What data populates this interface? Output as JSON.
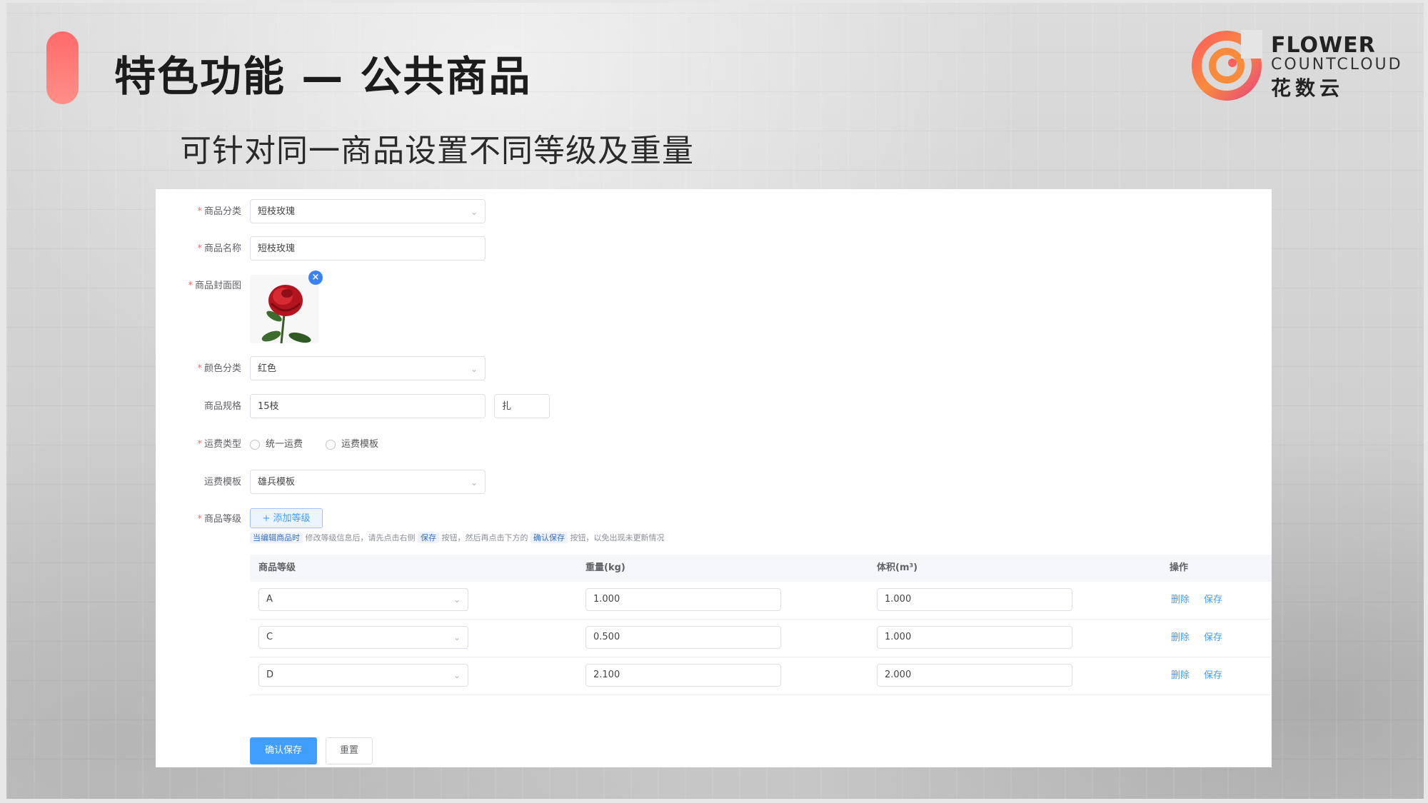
{
  "slide": {
    "title": "特色功能 — 公共商品",
    "subtitle": "可针对同一商品设置不同等级及重量"
  },
  "logo": {
    "line1": "FLOWER",
    "line2": "COUNTCLOUD",
    "line3": "花数云",
    "colors": [
      "#ff5f5f",
      "#f98b3c",
      "#e94b7a"
    ]
  },
  "form": {
    "category": {
      "label": "商品分类",
      "value": "短枝玫瑰",
      "required": "*"
    },
    "name": {
      "label": "商品名称",
      "value": "短枝玫瑰",
      "required": "*"
    },
    "cover": {
      "label": "商品封面图",
      "required": "*",
      "remove_icon": "×"
    },
    "color": {
      "label": "颜色分类",
      "value": "红色",
      "required": "*"
    },
    "spec": {
      "label": "商品规格",
      "value": "15枝",
      "unit": "扎"
    },
    "shipping_type": {
      "label": "运费类型",
      "required": "*",
      "options": [
        "统一运费",
        "运费模板"
      ]
    },
    "shipping_template": {
      "label": "运费模板",
      "value": "雄兵模板"
    },
    "grade": {
      "label": "商品等级",
      "required": "*",
      "add_button": "+ 添加等级",
      "hint_tag1": "当编辑商品时",
      "hint_text1": "修改等级信息后，请先点击右侧",
      "hint_tag2": "保存",
      "hint_text2": "按钮，然后再点击下方的",
      "hint_tag3": "确认保存",
      "hint_text3": "按钮，以免出现未更新情况"
    }
  },
  "table": {
    "headers": [
      "商品等级",
      "重量(kg)",
      "体积(m³)",
      "操作"
    ],
    "rows": [
      {
        "grade": "A",
        "weight": "1.000",
        "volume": "1.000"
      },
      {
        "grade": "C",
        "weight": "0.500",
        "volume": "1.000"
      },
      {
        "grade": "D",
        "weight": "2.100",
        "volume": "2.000"
      }
    ],
    "delete_label": "删除",
    "save_label": "保存"
  },
  "actions": {
    "confirm": "确认保存",
    "reset": "重置"
  },
  "theme": {
    "accent": "#409eff",
    "brand_red": "#ff6b6b"
  }
}
